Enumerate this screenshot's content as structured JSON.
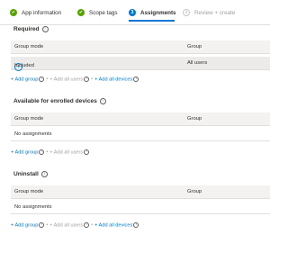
{
  "wizard": {
    "steps": [
      {
        "label": "App information",
        "state": "done",
        "icon": "check-icon"
      },
      {
        "label": "Scope tags",
        "state": "done",
        "icon": "check-icon"
      },
      {
        "label": "Assignments",
        "state": "current",
        "number": "3"
      },
      {
        "label": "Review + create",
        "state": "future",
        "number": "4"
      }
    ]
  },
  "sections": [
    {
      "title": "Required",
      "columns": [
        "Group mode",
        "Group"
      ],
      "rows": [
        {
          "mode": "Included",
          "group": "All users",
          "icon": "plus-circle-icon"
        }
      ],
      "links": {
        "add_group": "+ Add group",
        "add_all_users": "+ Add all users",
        "add_all_devices": "+ Add all devices"
      }
    },
    {
      "title": "Available for enrolled devices",
      "columns": [
        "Group mode",
        "Group"
      ],
      "empty_text": "No assignments",
      "links": {
        "add_group": "+ Add group",
        "add_all_users": "+ Add all users"
      }
    },
    {
      "title": "Uninstall",
      "columns": [
        "Group mode",
        "Group"
      ],
      "empty_text": "No assignments",
      "links": {
        "add_group": "+ Add group",
        "add_all_users": "+ Add all users",
        "add_all_devices": "+ Add all devices"
      }
    }
  ],
  "colors": {
    "accent": "#0078d4",
    "done": "#57a300",
    "disabled": "#a19f9d"
  }
}
